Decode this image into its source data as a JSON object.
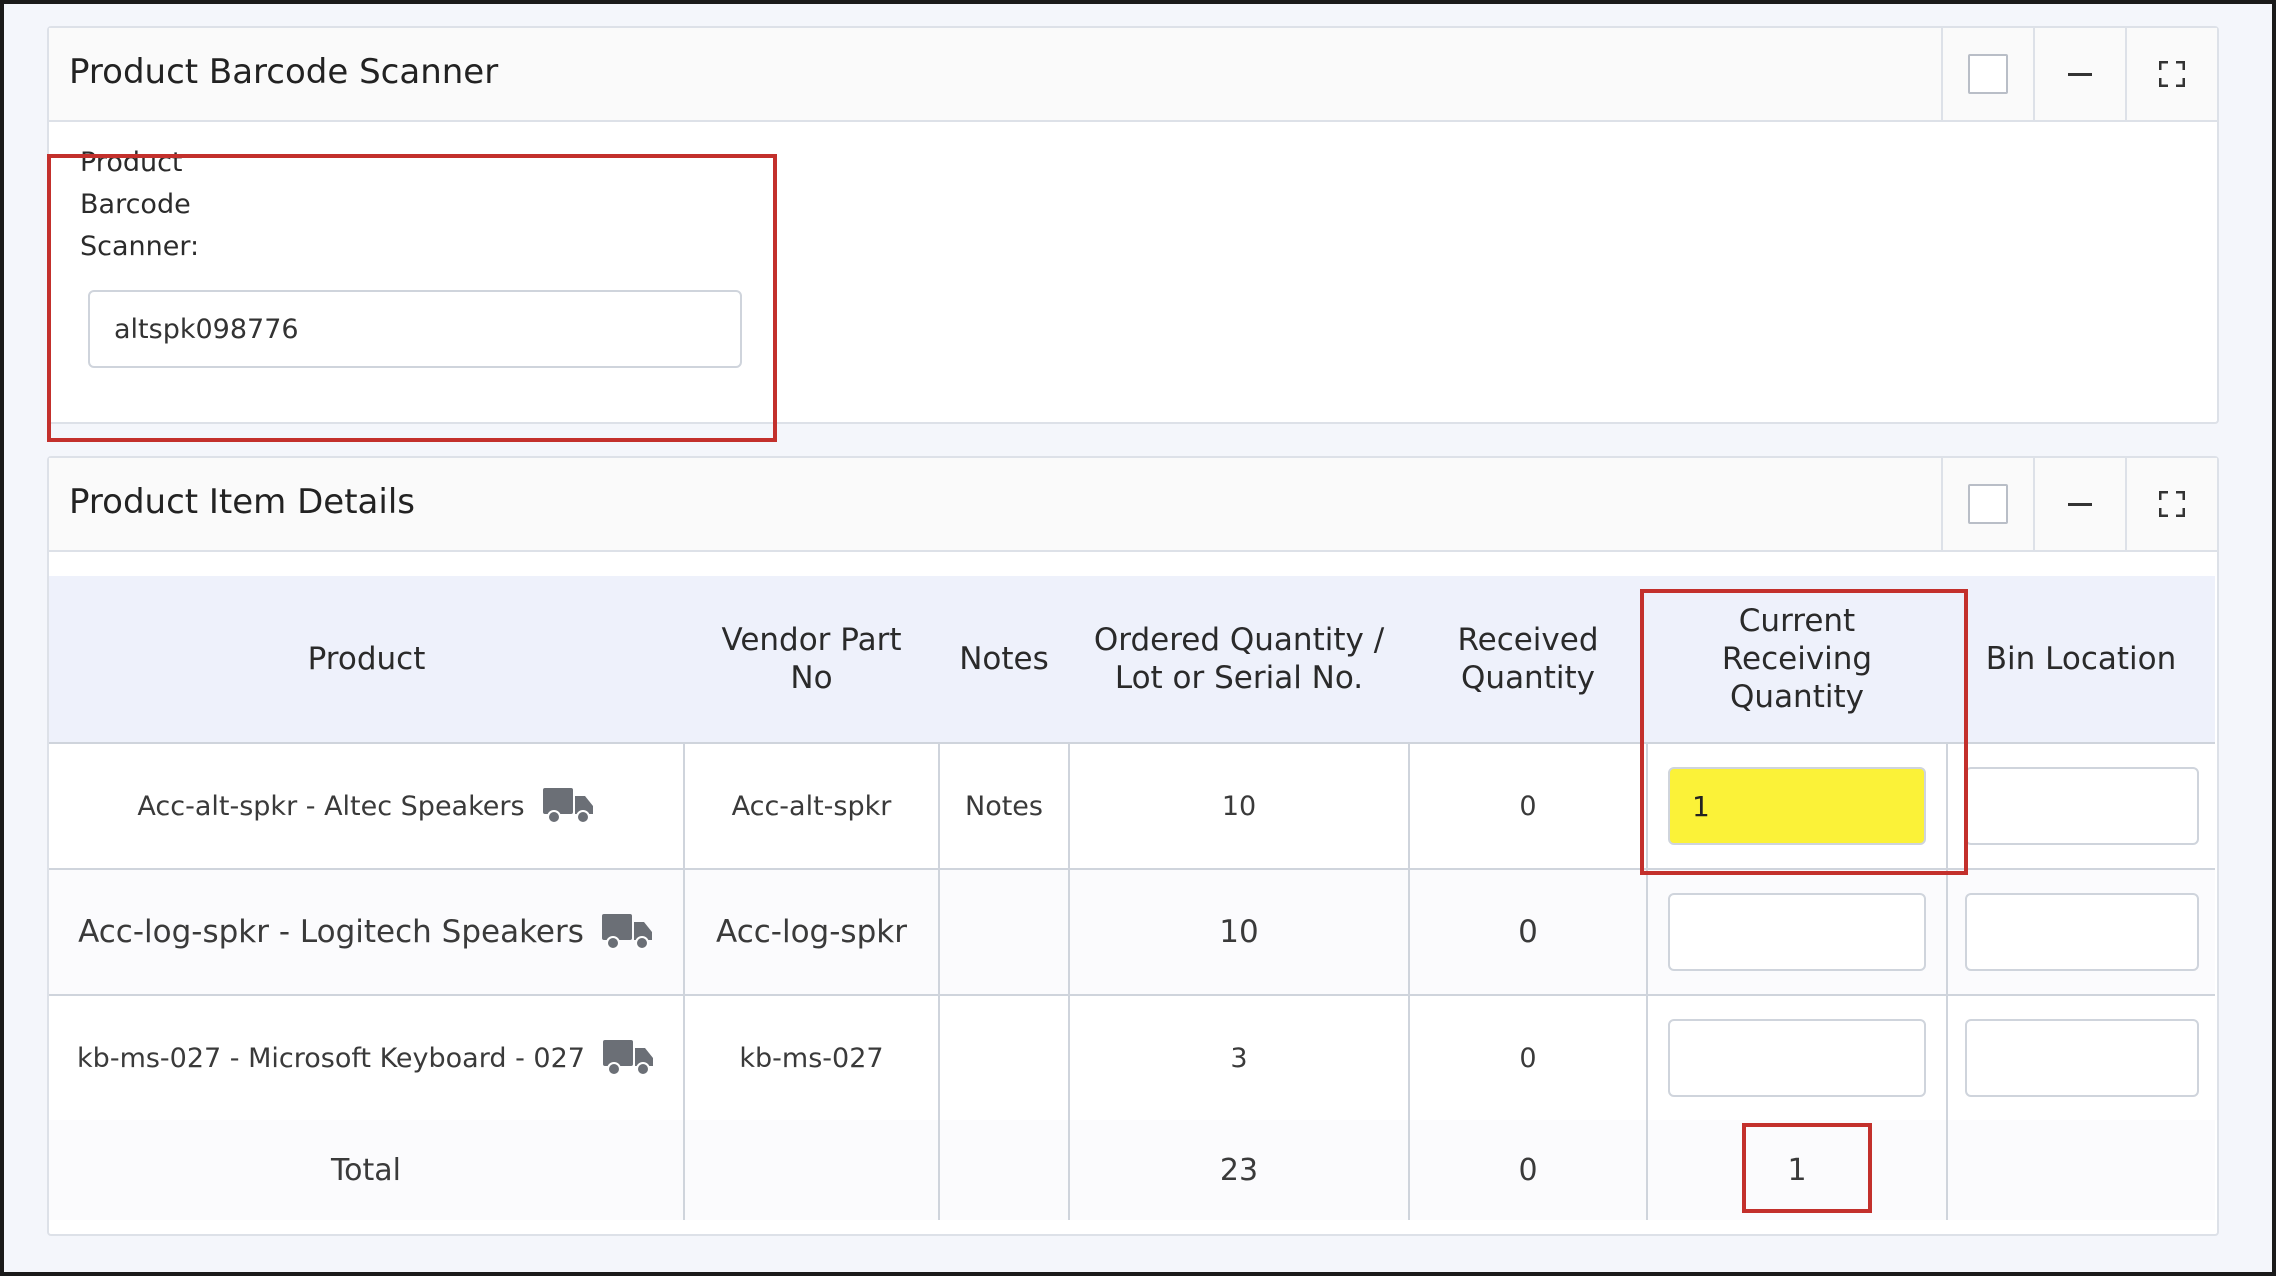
{
  "scanner_panel": {
    "title": "Product Barcode Scanner",
    "label_line1": "Product",
    "label_line2": "Barcode",
    "label_line3": "Scanner:",
    "barcode_value": "altspk098776"
  },
  "details_panel": {
    "title": "Product Item Details",
    "columns": {
      "product": "Product",
      "vendor_l1": "Vendor Part",
      "vendor_l2": "No",
      "notes": "Notes",
      "ordered_l1": "Ordered Quantity /",
      "ordered_l2": "Lot or Serial No.",
      "received_l1": "Received",
      "received_l2": "Quantity",
      "current_l1": "Current",
      "current_l2": "Receiving",
      "current_l3": "Quantity",
      "bin": "Bin Location"
    },
    "rows": [
      {
        "product": "Acc-alt-spkr - Altec Speakers",
        "vendor_part": "Acc-alt-spkr",
        "notes": "Notes",
        "ordered": "10",
        "received": "0",
        "current_receiving": "1",
        "bin_location": ""
      },
      {
        "product": "Acc-log-spkr - Logitech Speakers",
        "vendor_part": "Acc-log-spkr",
        "notes": "",
        "ordered": "10",
        "received": "0",
        "current_receiving": "",
        "bin_location": ""
      },
      {
        "product": "kb-ms-027 - Microsoft Keyboard - 027",
        "vendor_part": "kb-ms-027",
        "notes": "",
        "ordered": "3",
        "received": "0",
        "current_receiving": "",
        "bin_location": ""
      }
    ],
    "total": {
      "label": "Total",
      "ordered": "23",
      "received": "0",
      "current_receiving": "1"
    }
  },
  "colors": {
    "highlight": "#fbf238",
    "annotation_red": "#c3302c",
    "header_bg": "#eef1fb"
  },
  "icons": [
    "checkbox-icon",
    "minimize-icon",
    "expand-icon",
    "truck-icon"
  ]
}
